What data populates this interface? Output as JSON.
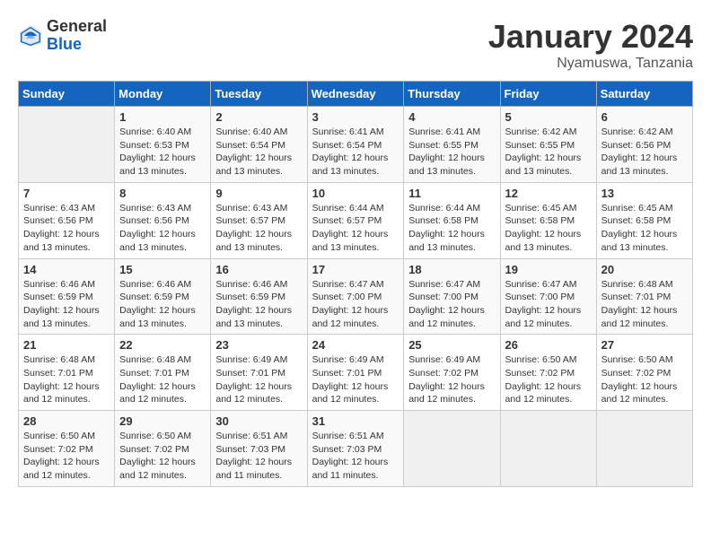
{
  "logo": {
    "general": "General",
    "blue": "Blue"
  },
  "title": {
    "month_year": "January 2024",
    "location": "Nyamuswa, Tanzania"
  },
  "days_of_week": [
    "Sunday",
    "Monday",
    "Tuesday",
    "Wednesday",
    "Thursday",
    "Friday",
    "Saturday"
  ],
  "weeks": [
    [
      {
        "day": "",
        "sunrise": "",
        "sunset": "",
        "daylight": "",
        "empty": true
      },
      {
        "day": "1",
        "sunrise": "Sunrise: 6:40 AM",
        "sunset": "Sunset: 6:53 PM",
        "daylight": "Daylight: 12 hours and 13 minutes."
      },
      {
        "day": "2",
        "sunrise": "Sunrise: 6:40 AM",
        "sunset": "Sunset: 6:54 PM",
        "daylight": "Daylight: 12 hours and 13 minutes."
      },
      {
        "day": "3",
        "sunrise": "Sunrise: 6:41 AM",
        "sunset": "Sunset: 6:54 PM",
        "daylight": "Daylight: 12 hours and 13 minutes."
      },
      {
        "day": "4",
        "sunrise": "Sunrise: 6:41 AM",
        "sunset": "Sunset: 6:55 PM",
        "daylight": "Daylight: 12 hours and 13 minutes."
      },
      {
        "day": "5",
        "sunrise": "Sunrise: 6:42 AM",
        "sunset": "Sunset: 6:55 PM",
        "daylight": "Daylight: 12 hours and 13 minutes."
      },
      {
        "day": "6",
        "sunrise": "Sunrise: 6:42 AM",
        "sunset": "Sunset: 6:56 PM",
        "daylight": "Daylight: 12 hours and 13 minutes."
      }
    ],
    [
      {
        "day": "7",
        "sunrise": "Sunrise: 6:43 AM",
        "sunset": "Sunset: 6:56 PM",
        "daylight": "Daylight: 12 hours and 13 minutes."
      },
      {
        "day": "8",
        "sunrise": "Sunrise: 6:43 AM",
        "sunset": "Sunset: 6:56 PM",
        "daylight": "Daylight: 12 hours and 13 minutes."
      },
      {
        "day": "9",
        "sunrise": "Sunrise: 6:43 AM",
        "sunset": "Sunset: 6:57 PM",
        "daylight": "Daylight: 12 hours and 13 minutes."
      },
      {
        "day": "10",
        "sunrise": "Sunrise: 6:44 AM",
        "sunset": "Sunset: 6:57 PM",
        "daylight": "Daylight: 12 hours and 13 minutes."
      },
      {
        "day": "11",
        "sunrise": "Sunrise: 6:44 AM",
        "sunset": "Sunset: 6:58 PM",
        "daylight": "Daylight: 12 hours and 13 minutes."
      },
      {
        "day": "12",
        "sunrise": "Sunrise: 6:45 AM",
        "sunset": "Sunset: 6:58 PM",
        "daylight": "Daylight: 12 hours and 13 minutes."
      },
      {
        "day": "13",
        "sunrise": "Sunrise: 6:45 AM",
        "sunset": "Sunset: 6:58 PM",
        "daylight": "Daylight: 12 hours and 13 minutes."
      }
    ],
    [
      {
        "day": "14",
        "sunrise": "Sunrise: 6:46 AM",
        "sunset": "Sunset: 6:59 PM",
        "daylight": "Daylight: 12 hours and 13 minutes."
      },
      {
        "day": "15",
        "sunrise": "Sunrise: 6:46 AM",
        "sunset": "Sunset: 6:59 PM",
        "daylight": "Daylight: 12 hours and 13 minutes."
      },
      {
        "day": "16",
        "sunrise": "Sunrise: 6:46 AM",
        "sunset": "Sunset: 6:59 PM",
        "daylight": "Daylight: 12 hours and 13 minutes."
      },
      {
        "day": "17",
        "sunrise": "Sunrise: 6:47 AM",
        "sunset": "Sunset: 7:00 PM",
        "daylight": "Daylight: 12 hours and 12 minutes."
      },
      {
        "day": "18",
        "sunrise": "Sunrise: 6:47 AM",
        "sunset": "Sunset: 7:00 PM",
        "daylight": "Daylight: 12 hours and 12 minutes."
      },
      {
        "day": "19",
        "sunrise": "Sunrise: 6:47 AM",
        "sunset": "Sunset: 7:00 PM",
        "daylight": "Daylight: 12 hours and 12 minutes."
      },
      {
        "day": "20",
        "sunrise": "Sunrise: 6:48 AM",
        "sunset": "Sunset: 7:01 PM",
        "daylight": "Daylight: 12 hours and 12 minutes."
      }
    ],
    [
      {
        "day": "21",
        "sunrise": "Sunrise: 6:48 AM",
        "sunset": "Sunset: 7:01 PM",
        "daylight": "Daylight: 12 hours and 12 minutes."
      },
      {
        "day": "22",
        "sunrise": "Sunrise: 6:48 AM",
        "sunset": "Sunset: 7:01 PM",
        "daylight": "Daylight: 12 hours and 12 minutes."
      },
      {
        "day": "23",
        "sunrise": "Sunrise: 6:49 AM",
        "sunset": "Sunset: 7:01 PM",
        "daylight": "Daylight: 12 hours and 12 minutes."
      },
      {
        "day": "24",
        "sunrise": "Sunrise: 6:49 AM",
        "sunset": "Sunset: 7:01 PM",
        "daylight": "Daylight: 12 hours and 12 minutes."
      },
      {
        "day": "25",
        "sunrise": "Sunrise: 6:49 AM",
        "sunset": "Sunset: 7:02 PM",
        "daylight": "Daylight: 12 hours and 12 minutes."
      },
      {
        "day": "26",
        "sunrise": "Sunrise: 6:50 AM",
        "sunset": "Sunset: 7:02 PM",
        "daylight": "Daylight: 12 hours and 12 minutes."
      },
      {
        "day": "27",
        "sunrise": "Sunrise: 6:50 AM",
        "sunset": "Sunset: 7:02 PM",
        "daylight": "Daylight: 12 hours and 12 minutes."
      }
    ],
    [
      {
        "day": "28",
        "sunrise": "Sunrise: 6:50 AM",
        "sunset": "Sunset: 7:02 PM",
        "daylight": "Daylight: 12 hours and 12 minutes."
      },
      {
        "day": "29",
        "sunrise": "Sunrise: 6:50 AM",
        "sunset": "Sunset: 7:02 PM",
        "daylight": "Daylight: 12 hours and 12 minutes."
      },
      {
        "day": "30",
        "sunrise": "Sunrise: 6:51 AM",
        "sunset": "Sunset: 7:03 PM",
        "daylight": "Daylight: 12 hours and 11 minutes."
      },
      {
        "day": "31",
        "sunrise": "Sunrise: 6:51 AM",
        "sunset": "Sunset: 7:03 PM",
        "daylight": "Daylight: 12 hours and 11 minutes."
      },
      {
        "day": "",
        "sunrise": "",
        "sunset": "",
        "daylight": "",
        "empty": true
      },
      {
        "day": "",
        "sunrise": "",
        "sunset": "",
        "daylight": "",
        "empty": true
      },
      {
        "day": "",
        "sunrise": "",
        "sunset": "",
        "daylight": "",
        "empty": true
      }
    ]
  ]
}
